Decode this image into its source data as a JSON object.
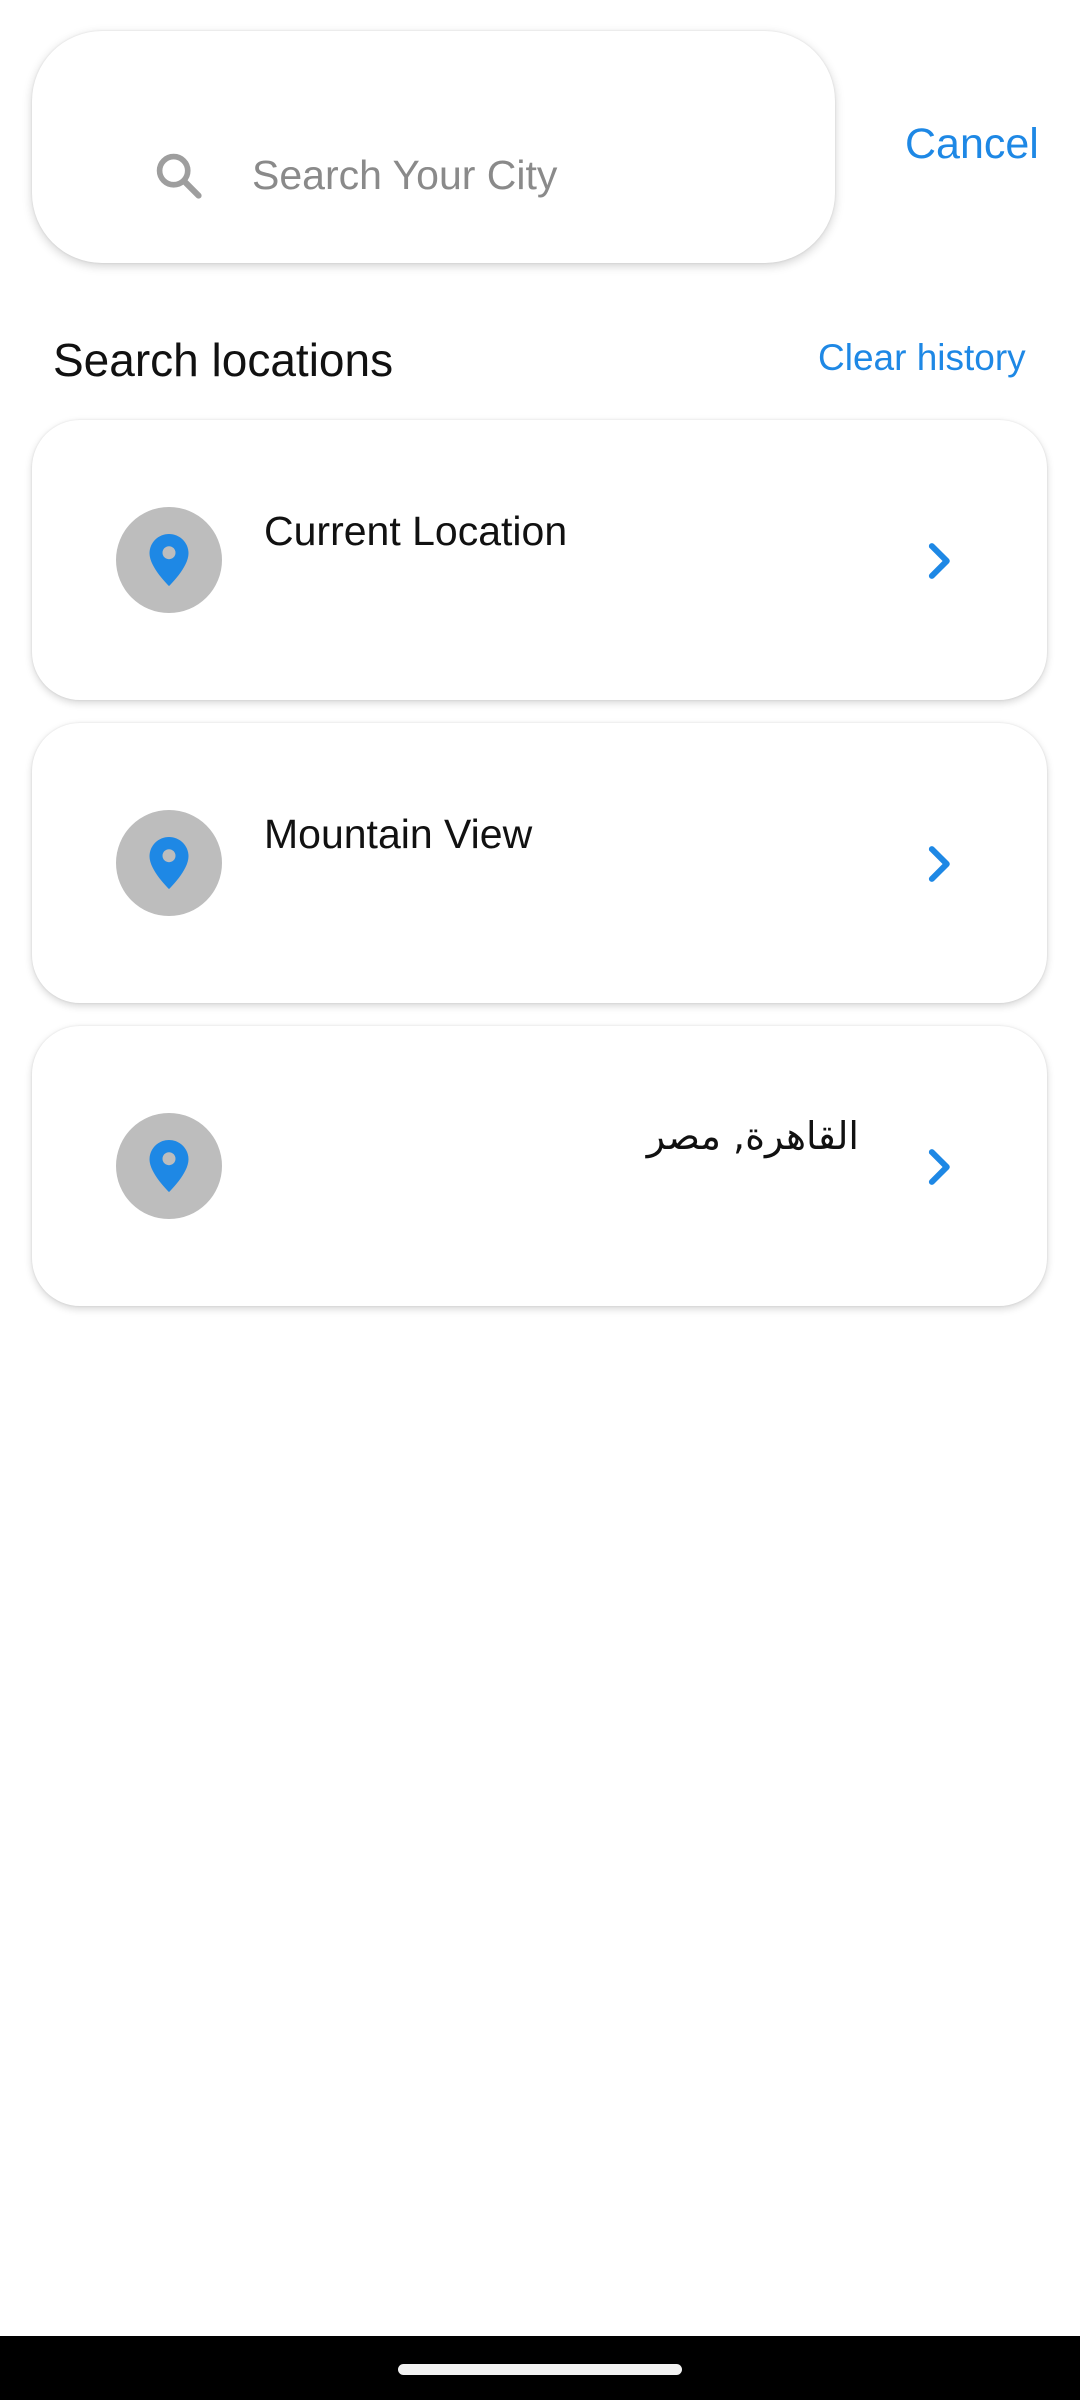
{
  "search": {
    "placeholder": "Search Your City",
    "cancel_label": "Cancel"
  },
  "section": {
    "title": "Search locations",
    "clear_label": "Clear history"
  },
  "locations": [
    {
      "label": "Current Location",
      "icon": "location-pin-icon"
    },
    {
      "label": "Mountain View",
      "icon": "location-pin-icon"
    },
    {
      "label": "القاهرة, مصر",
      "icon": "location-pin-icon"
    }
  ],
  "colors": {
    "accent": "#1e88e5",
    "pin_background": "#bdbdbd",
    "text_primary": "#111111",
    "placeholder": "#8a8a8a"
  }
}
